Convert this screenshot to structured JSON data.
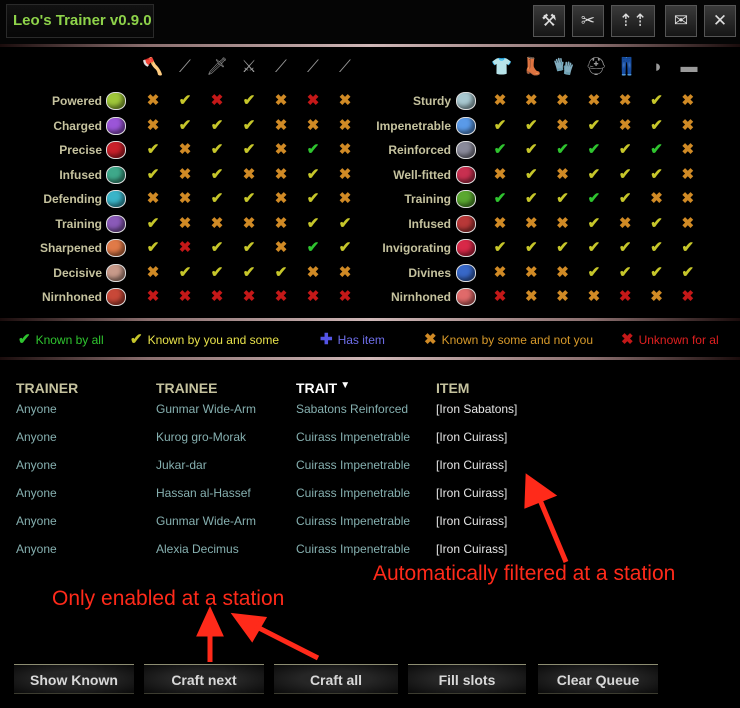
{
  "window": {
    "title": "Leo's Trainer v0.9.0"
  },
  "toolbar": {
    "icons": [
      "anvil-icon",
      "crossed-tools-icon",
      "arrows-up-icon",
      "mail-icon",
      "close-icon"
    ]
  },
  "grid": {
    "weapon_icons": [
      "axe-icon",
      "mace-icon",
      "sword-icon",
      "battle-axe-icon",
      "maul-icon",
      "greatsword-icon",
      "dagger-icon"
    ],
    "armor_icons": [
      "cuirass-icon",
      "sabatons-icon",
      "gauntlets-icon",
      "helmet-icon",
      "greaves-icon",
      "pauldron-icon",
      "girdle-icon"
    ],
    "weapon_traits": [
      {
        "name": "Powered",
        "gem_color": "#9fc73a",
        "marks": [
          "o",
          "y",
          "r",
          "y",
          "o",
          "r",
          "o"
        ]
      },
      {
        "name": "Charged",
        "gem_color": "#9b55d8",
        "marks": [
          "o",
          "y",
          "y",
          "y",
          "o",
          "o",
          "o"
        ]
      },
      {
        "name": "Precise",
        "gem_color": "#c8202a",
        "marks": [
          "y",
          "o",
          "y",
          "y",
          "o",
          "g",
          "o"
        ]
      },
      {
        "name": "Infused",
        "gem_color": "#3ea88a",
        "marks": [
          "y",
          "o",
          "y",
          "o",
          "o",
          "y",
          "o"
        ]
      },
      {
        "name": "Defending",
        "gem_color": "#3ab4c8",
        "marks": [
          "o",
          "o",
          "y",
          "y",
          "o",
          "y",
          "o"
        ]
      },
      {
        "name": "Training",
        "gem_color": "#8a5ab8",
        "marks": [
          "y",
          "o",
          "o",
          "o",
          "o",
          "y",
          "y"
        ]
      },
      {
        "name": "Sharpened",
        "gem_color": "#e07a48",
        "marks": [
          "y",
          "r",
          "y",
          "y",
          "o",
          "g",
          "y"
        ]
      },
      {
        "name": "Decisive",
        "gem_color": "#c89a8a",
        "marks": [
          "o",
          "y",
          "y",
          "y",
          "y",
          "o",
          "o"
        ]
      },
      {
        "name": "Nirnhoned",
        "gem_color": "#c84838",
        "marks": [
          "r",
          "r",
          "r",
          "r",
          "r",
          "r",
          "r"
        ]
      }
    ],
    "armor_traits": [
      {
        "name": "Sturdy",
        "gem_color": "#a8c8d0",
        "marks": [
          "o",
          "o",
          "o",
          "o",
          "o",
          "y",
          "o"
        ]
      },
      {
        "name": "Impenetrable",
        "gem_color": "#5a9ae8",
        "marks": [
          "y",
          "y",
          "o",
          "y",
          "o",
          "y",
          "o"
        ]
      },
      {
        "name": "Reinforced",
        "gem_color": "#8a8a9a",
        "marks": [
          "g",
          "y",
          "g",
          "g",
          "y",
          "g",
          "o"
        ]
      },
      {
        "name": "Well-fitted",
        "gem_color": "#c83050",
        "marks": [
          "o",
          "y",
          "o",
          "y",
          "y",
          "y",
          "o"
        ]
      },
      {
        "name": "Training",
        "gem_color": "#5aa830",
        "marks": [
          "g",
          "y",
          "y",
          "g",
          "y",
          "o",
          "o"
        ]
      },
      {
        "name": "Infused",
        "gem_color": "#b83838",
        "marks": [
          "o",
          "o",
          "o",
          "y",
          "o",
          "y",
          "o"
        ]
      },
      {
        "name": "Invigorating",
        "gem_color": "#d82848",
        "marks": [
          "y",
          "y",
          "y",
          "y",
          "y",
          "y",
          "y"
        ]
      },
      {
        "name": "Divines",
        "gem_color": "#3868c8",
        "marks": [
          "o",
          "o",
          "o",
          "y",
          "y",
          "y",
          "y"
        ]
      },
      {
        "name": "Nirnhoned",
        "gem_color": "#e06a6a",
        "marks": [
          "r",
          "o",
          "o",
          "o",
          "r",
          "o",
          "r"
        ]
      }
    ]
  },
  "legend": [
    {
      "mark": "✔",
      "cls": "m-g",
      "label": "Known by all",
      "color": "#2fc42f"
    },
    {
      "mark": "✔",
      "cls": "m-y",
      "label": "Known by you and some",
      "color": "#e8e24a"
    },
    {
      "mark": "✚",
      "cls": "m-b",
      "label": "Has item",
      "color": "#6e6eea"
    },
    {
      "mark": "✖",
      "cls": "m-o",
      "label": "Known by some and not you",
      "color": "#d89a2a"
    },
    {
      "mark": "✖",
      "cls": "m-r",
      "label": "Unknown for al",
      "color": "#e02020"
    }
  ],
  "table": {
    "headers": {
      "trainer": "TRAINER",
      "trainee": "TRAINEE",
      "trait": "TRAIT",
      "sort_indicator": "▼",
      "item": "ITEM"
    },
    "rows": [
      {
        "trainer": "Anyone",
        "trainee": "Gunmar Wide-Arm",
        "trait": "Sabatons Reinforced",
        "item": "[Iron Sabatons]"
      },
      {
        "trainer": "Anyone",
        "trainee": "Kurog gro-Morak",
        "trait": "Cuirass Impenetrable",
        "item": "[Iron Cuirass]"
      },
      {
        "trainer": "Anyone",
        "trainee": "Jukar-dar",
        "trait": "Cuirass Impenetrable",
        "item": "[Iron Cuirass]"
      },
      {
        "trainer": "Anyone",
        "trainee": "Hassan al-Hassef",
        "trait": "Cuirass Impenetrable",
        "item": "[Iron Cuirass]"
      },
      {
        "trainer": "Anyone",
        "trainee": "Gunmar Wide-Arm",
        "trait": "Cuirass Impenetrable",
        "item": "[Iron Cuirass]"
      },
      {
        "trainer": "Anyone",
        "trainee": "Alexia Decimus",
        "trait": "Cuirass Impenetrable",
        "item": "[Iron Cuirass]"
      }
    ]
  },
  "annotations": {
    "filtered": "Automatically filtered at a station",
    "station": "Only enabled at a station",
    "color": "#ff2a1a"
  },
  "buttons": {
    "show_known": "Show Known",
    "craft_next": "Craft next",
    "craft_all": "Craft all",
    "fill_slots": "Fill slots",
    "clear_queue": "Clear Queue"
  }
}
